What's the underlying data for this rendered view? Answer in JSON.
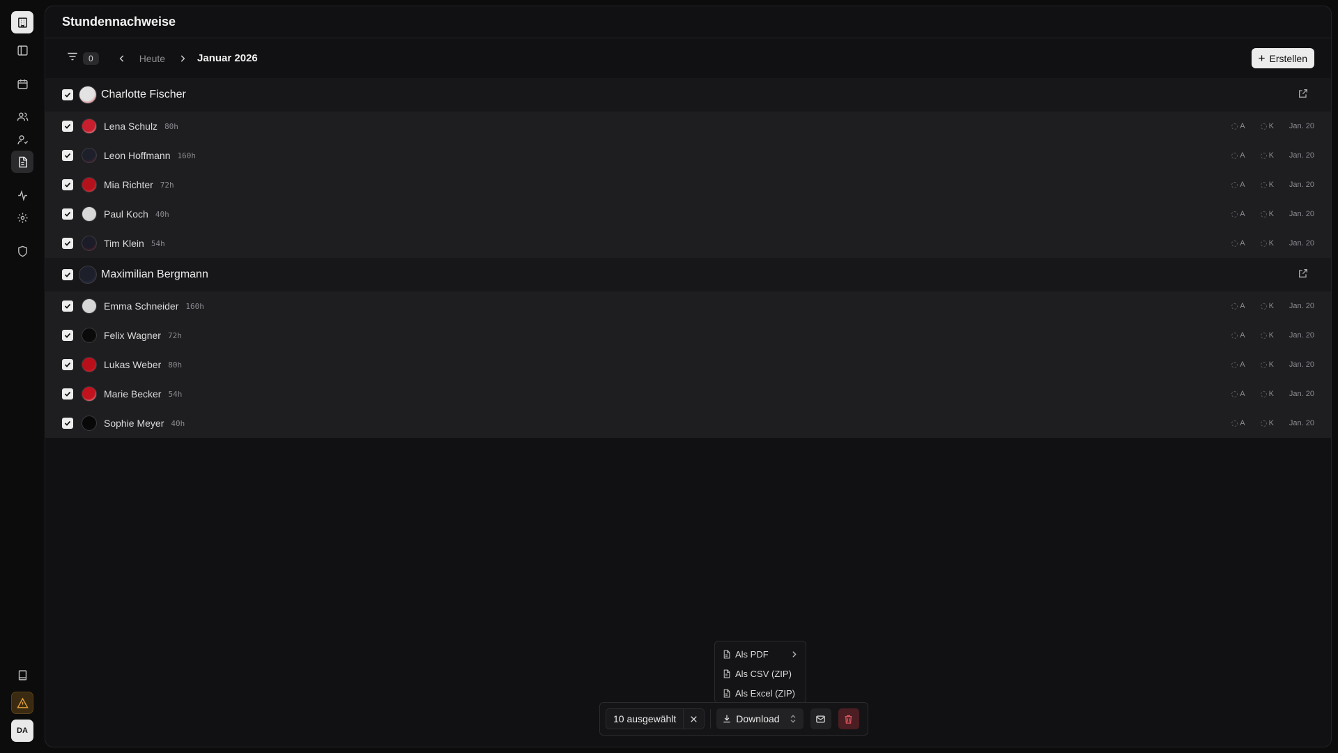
{
  "rail": {
    "items": [
      "building-icon",
      "sidebar-toggle-icon",
      "calendar-icon",
      "users-icon",
      "user-icon",
      "document-icon",
      "activity-icon",
      "settings-icon",
      "shield-icon"
    ],
    "bottom": [
      "book-icon",
      "warning-icon"
    ],
    "avatar_initials": "DA"
  },
  "header": {
    "title": "Stundennachweise"
  },
  "toolbar": {
    "filter_count": "0",
    "today_label": "Heute",
    "month_label": "Januar 2026",
    "create_label": "Erstellen"
  },
  "groups": [
    {
      "name": "Charlotte Fischer",
      "rows": [
        {
          "name": "Lena Schulz",
          "hours": "80h",
          "tag_a": "A",
          "tag_k": "K",
          "date": "Jan. 20"
        },
        {
          "name": "Leon Hoffmann",
          "hours": "160h",
          "tag_a": "A",
          "tag_k": "K",
          "date": "Jan. 20"
        },
        {
          "name": "Mia Richter",
          "hours": "72h",
          "tag_a": "A",
          "tag_k": "K",
          "date": "Jan. 20"
        },
        {
          "name": "Paul Koch",
          "hours": "40h",
          "tag_a": "A",
          "tag_k": "K",
          "date": "Jan. 20"
        },
        {
          "name": "Tim Klein",
          "hours": "54h",
          "tag_a": "A",
          "tag_k": "K",
          "date": "Jan. 20"
        }
      ]
    },
    {
      "name": "Maximilian Bergmann",
      "rows": [
        {
          "name": "Emma Schneider",
          "hours": "160h",
          "tag_a": "A",
          "tag_k": "K",
          "date": "Jan. 20"
        },
        {
          "name": "Felix Wagner",
          "hours": "72h",
          "tag_a": "A",
          "tag_k": "K",
          "date": "Jan. 20"
        },
        {
          "name": "Lukas Weber",
          "hours": "80h",
          "tag_a": "A",
          "tag_k": "K",
          "date": "Jan. 20"
        },
        {
          "name": "Marie Becker",
          "hours": "54h",
          "tag_a": "A",
          "tag_k": "K",
          "date": "Jan. 20"
        },
        {
          "name": "Sophie Meyer",
          "hours": "40h",
          "tag_a": "A",
          "tag_k": "K",
          "date": "Jan. 20"
        }
      ]
    }
  ],
  "download_menu": {
    "items": [
      "Als PDF",
      "Als CSV (ZIP)",
      "Als Excel (ZIP)"
    ]
  },
  "actionbar": {
    "selected_label": "10 ausgewählt",
    "download_label": "Download"
  },
  "colors": {
    "background": "#0c0c0d",
    "panel": "#111113",
    "row": "#1e1e21",
    "accent_light": "#ececec",
    "danger": "#e0565f",
    "warning": "#e0a03a"
  }
}
